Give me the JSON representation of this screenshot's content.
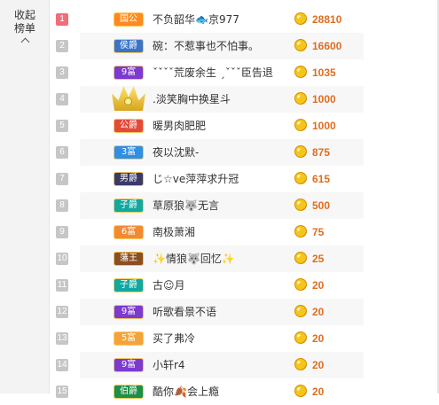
{
  "sidebar": {
    "collapse_label": "收起榜单"
  },
  "ranking": {
    "rows": [
      {
        "rank": "1",
        "badge": "国公",
        "badge_color": "#ff8a1f",
        "name": "不负韶华🐟京977",
        "score": "28810"
      },
      {
        "rank": "2",
        "badge": "侯爵",
        "badge_color": "#3b74c7",
        "name": "碗：不惹事也不怕事。",
        "score": "16600"
      },
      {
        "rank": "3",
        "badge": "9富",
        "badge_color": "#7c3ad0",
        "name": "ˇˇˇˇ荒废余生 ˏˇˇˇ臣告退",
        "score": "1035"
      },
      {
        "rank": "4",
        "badge": "",
        "badge_color": "#d9b340",
        "badge_icon": "crown-icon",
        "name": ".淡笑胸中换星斗",
        "score": "1000"
      },
      {
        "rank": "5",
        "badge": "公爵",
        "badge_color": "#e44a39",
        "name": "暖男肉肥肥",
        "score": "1000"
      },
      {
        "rank": "6",
        "badge": "3富",
        "badge_color": "#2f8ee6",
        "name": "夜以沈默-",
        "score": "875"
      },
      {
        "rank": "7",
        "badge": "男爵",
        "badge_color": "#3a3a6a",
        "name": "じ☆ve萍萍求升冠",
        "score": "615"
      },
      {
        "rank": "8",
        "badge": "子爵",
        "badge_color": "#12a8a0",
        "name": "草原狼🐺无言",
        "score": "500"
      },
      {
        "rank": "9",
        "badge": "6富",
        "badge_color": "#f28a34",
        "name": "南极萧湘",
        "score": "75"
      },
      {
        "rank": "10",
        "badge": "藩王",
        "badge_color": "#8b4d22",
        "name": "✨情狼🐺回忆✨",
        "score": "25"
      },
      {
        "rank": "11",
        "badge": "子爵",
        "badge_color": "#12a8a0",
        "name": "古☺月",
        "score": "20"
      },
      {
        "rank": "12",
        "badge": "9富",
        "badge_color": "#7c3ad0",
        "name": "听歌看景不语",
        "score": "20"
      },
      {
        "rank": "13",
        "badge": "5富",
        "badge_color": "#f4a33a",
        "name": "买了弗冷",
        "score": "20"
      },
      {
        "rank": "14",
        "badge": "9富",
        "badge_color": "#7c3ad0",
        "name": "小轩r4",
        "score": "20"
      },
      {
        "rank": "15",
        "badge": "伯爵",
        "badge_color": "#1f8f47",
        "name": "酷你🍂会上瘾",
        "score": "20"
      }
    ]
  }
}
